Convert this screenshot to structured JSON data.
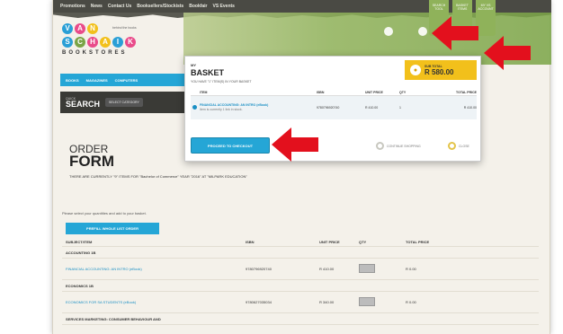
{
  "topbar": {
    "links": [
      "Promotions",
      "News",
      "Contact Us",
      "Booksellers/Stockists",
      "Bookfair",
      "VS Events"
    ]
  },
  "logo": {
    "top_letters": [
      "V",
      "A",
      "N"
    ],
    "bottom_letters": [
      "S",
      "C",
      "H",
      "A",
      "I",
      "K"
    ],
    "subtitle": "BOOKSTORES",
    "tagline": "behind the books",
    "colors": [
      "#2a9fd6",
      "#e94b8a",
      "#f2c01b",
      "#7aa446",
      "#e94b8a",
      "#2a9fd6"
    ]
  },
  "header_tabs": [
    {
      "label": "SEARCH TOOL"
    },
    {
      "label": "BASKET ITEMS"
    },
    {
      "label": "MY VS ACCOUNT"
    }
  ],
  "nav": {
    "items": [
      "BOOKS",
      "MAGAZINES",
      "COMPUTERS"
    ]
  },
  "search": {
    "quick": "QUICK",
    "title": "SEARCH",
    "category": "SELECT CATEGORY"
  },
  "order": {
    "title_line1": "ORDER",
    "title_line2": "FORM",
    "description": "THERE ARE CURRENTLY \"9\" ITEMS FOR \"Bachelor of Commerce\" YEAR \"2016\" AT \"MILPARK EDUCATION\"",
    "hint": "Please select your quantities and add to your basket.",
    "prefill_label": "PREFILL WHOLE LIST ORDER",
    "columns": [
      "SUBJECT/ITEM",
      "ISBN",
      "UNIT PRICE",
      "QTY",
      "TOTAL PRICE"
    ],
    "sections": [
      {
        "name": "ACCOUNTING 1B",
        "items": [
          {
            "title": "FINANCIAL ACCOUNTING: AN INTRO (eBook)",
            "isbn": "9780796920740",
            "unit": "R 410.00",
            "total": "R 0.00"
          }
        ]
      },
      {
        "name": "ECONOMICS 1B",
        "items": [
          {
            "title": "ECONOMICS FOR SA STUDENTS (eBook)",
            "isbn": "9780627035034",
            "unit": "R 340.00",
            "total": "R 0.00"
          }
        ]
      },
      {
        "name": "SERVICES MARKETING: CONSUMER BEHAVIOUR AND",
        "items": []
      }
    ]
  },
  "basket": {
    "my": "MY",
    "title": "BASKET",
    "count_text": "YOU HAVE \"1\" ITEM(S) IN YOUR BASKET",
    "subtotal_label": "SUB TOTAL",
    "subtotal_value": "R 580.00",
    "columns": [
      "ITEM",
      "ISBN",
      "UNIT PRICE",
      "QTY",
      "TOTAL PRICE"
    ],
    "items": [
      {
        "title": "FINANCIAL ACCOUNTING: AN INTRO (eBook)",
        "note": "Item is currently 1 link in stock.",
        "isbn": "9780796920740",
        "unit": "R 410.00",
        "qty": "1",
        "total": "R 410.00"
      }
    ],
    "proceed_label": "PROCEED TO CHECKOUT",
    "continue_label": "CONTINUE SHOPPING",
    "close_label": "CLOSE"
  },
  "colors": {
    "accent_blue": "#25a6d6",
    "arrow_red": "#e3101d",
    "subtotal_yellow": "#f2c01b",
    "hero_green": "#8fb25a"
  }
}
